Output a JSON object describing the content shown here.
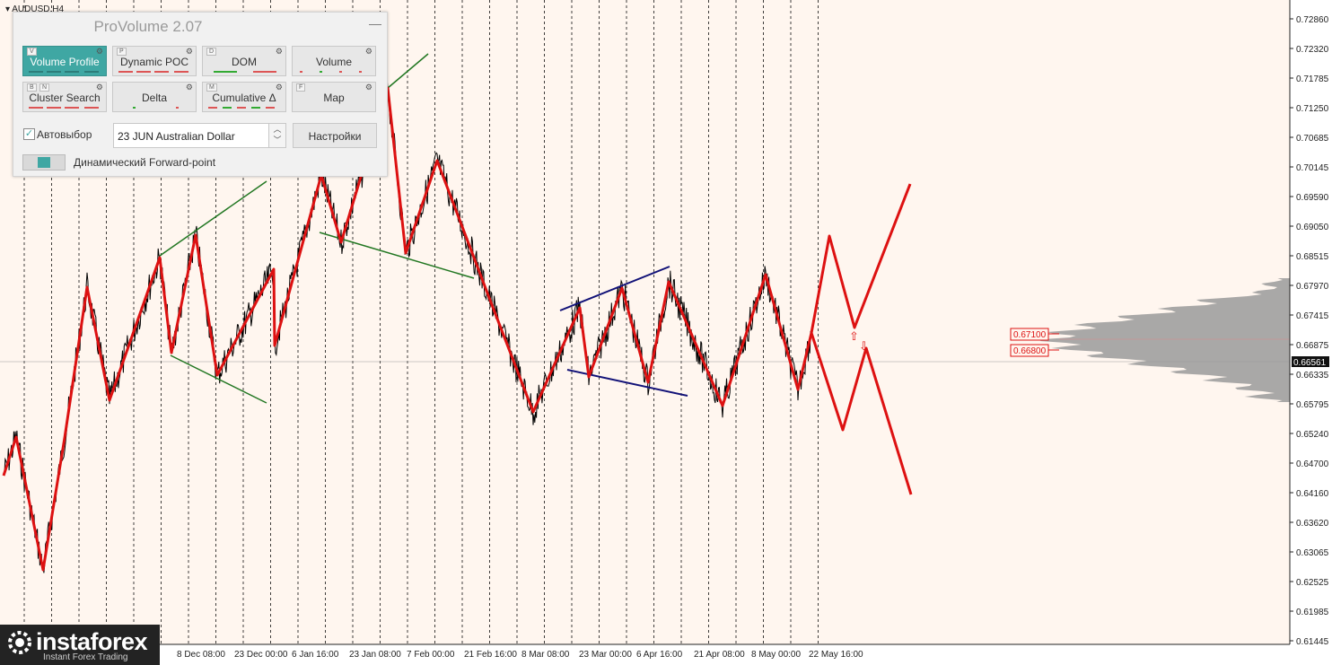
{
  "symbol": "AUDUSD,H4",
  "price_axis": [
    "0.72860",
    "0.72320",
    "0.71785",
    "0.71250",
    "0.70685",
    "0.70145",
    "0.69590",
    "0.69050",
    "0.68515",
    "0.67970",
    "0.67415",
    "0.66875",
    "0.66335",
    "0.65795",
    "0.65240",
    "0.64700",
    "0.64160",
    "0.63620",
    "0.63065",
    "0.62525",
    "0.61985",
    "0.61445"
  ],
  "current_price": "0.66561",
  "levels": [
    {
      "label": "0.67100"
    },
    {
      "label": "0.66800"
    }
  ],
  "time_axis": [
    "8 Dec 08:00",
    "23 Dec 00:00",
    "6 Jan 16:00",
    "23 Jan 08:00",
    "7 Feb 00:00",
    "21 Feb 16:00",
    "8 Mar 08:00",
    "23 Mar 00:00",
    "6 Apr 16:00",
    "21 Apr 08:00",
    "8 May 00:00",
    "22 May 16:00"
  ],
  "panel": {
    "title": "ProVolume 2.07",
    "buttons": [
      {
        "label": "Volume Profile",
        "key": "V",
        "active": true
      },
      {
        "label": "Dynamic POC",
        "key": "P"
      },
      {
        "label": "DOM",
        "key": "D"
      },
      {
        "label": "Volume",
        "key": ""
      },
      {
        "label": "Cluster Search",
        "key": "B",
        "key2": "N"
      },
      {
        "label": "Delta",
        "key": ""
      },
      {
        "label": "Cumulative Δ",
        "key": "M"
      },
      {
        "label": "Map",
        "key": "F"
      }
    ],
    "auto_select_label": "Автовыбор",
    "instrument": "23 JUN Australian Dollar",
    "settings_label": "Настройки",
    "forward_point_label": "Динамический Forward-point"
  },
  "logo": {
    "name": "instaforex",
    "tagline": "Instant Forex Trading"
  },
  "colors": {
    "background": "#fff6ef",
    "zigzag": "#dd1111",
    "price": "#000000",
    "green_line": "#227722",
    "navy_line": "#111177",
    "profile": "#9a9a9a",
    "accent": "#3fa7a3"
  }
}
